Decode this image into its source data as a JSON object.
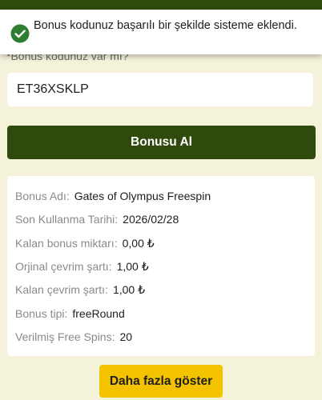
{
  "toast": {
    "icon": "check-circle-icon",
    "color": "#2e7d32",
    "message": "Bonus kodunuz başarılı bir şekilde sisteme eklendi."
  },
  "form": {
    "label_required_mark": "*",
    "label": "Bonus kodunuz var mı?",
    "code_value": "ET36XSKLP",
    "submit_label": "Bonusu Al"
  },
  "bonus_details": [
    {
      "key": "Bonus Adı:",
      "value": "Gates of Olympus Freespin"
    },
    {
      "key": "Son Kullanma Tarihi:",
      "value": "2026/02/28"
    },
    {
      "key": "Kalan bonus miktarı:",
      "value": "0,00 ₺"
    },
    {
      "key": "Orjinal çevrim şartı:",
      "value": "1,00 ₺"
    },
    {
      "key": "Kalan çevrim şartı:",
      "value": "1,00 ₺"
    },
    {
      "key": "Bonus tipi:",
      "value": "freeRound"
    },
    {
      "key": "Verilmiş Free Spins:",
      "value": "20"
    }
  ],
  "more_button_label": "Daha fazla göster",
  "colors": {
    "brand_green": "#2f4a0c",
    "accent_yellow": "#f3c300",
    "background": "#f4f2d9"
  }
}
